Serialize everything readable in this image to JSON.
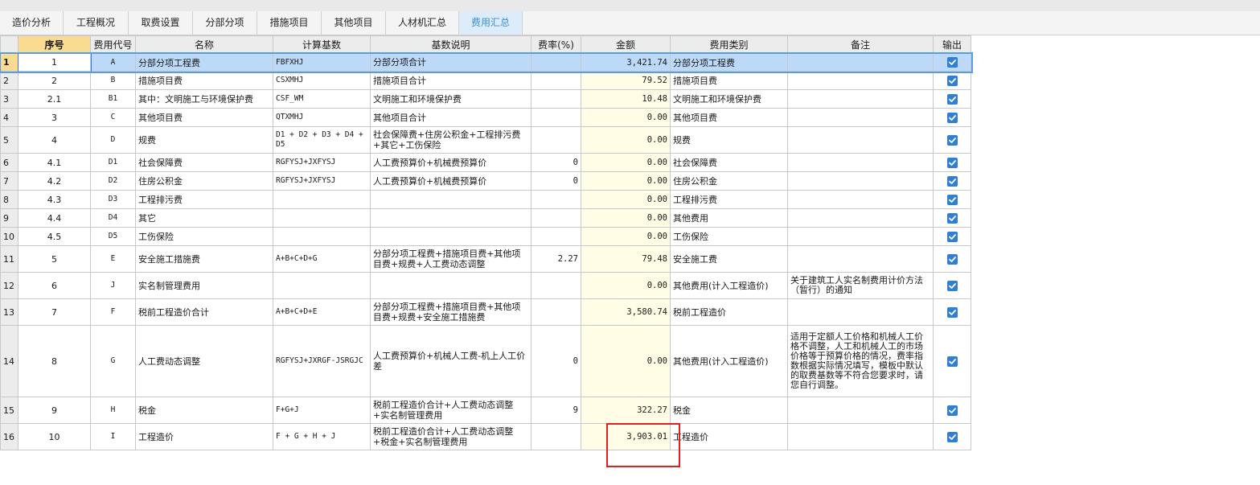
{
  "tabs": [
    {
      "label": "造价分析"
    },
    {
      "label": "工程概况"
    },
    {
      "label": "取费设置"
    },
    {
      "label": "分部分项"
    },
    {
      "label": "措施项目"
    },
    {
      "label": "其他项目"
    },
    {
      "label": "人材机汇总"
    },
    {
      "label": "费用汇总"
    }
  ],
  "table": {
    "headers": [
      "序号",
      "费用代号",
      "名称",
      "计算基数",
      "基数说明",
      "费率(%)",
      "金额",
      "费用类别",
      "备注",
      "输出"
    ],
    "rows": [
      {
        "rn": "1",
        "seq": "1",
        "code": "A",
        "name": "分部分项工程费",
        "base": "FBFXHJ",
        "desc": "分部分项合计",
        "rate": "",
        "amount": "3,421.74",
        "category": "分部分项工程费",
        "note": "",
        "output": true
      },
      {
        "rn": "2",
        "seq": "2",
        "code": "B",
        "name": "措施项目费",
        "base": "CSXMHJ",
        "desc": "措施项目合计",
        "rate": "",
        "amount": "79.52",
        "category": "措施项目费",
        "note": "",
        "output": true
      },
      {
        "rn": "3",
        "seq": "2.1",
        "code": "B1",
        "name": "其中：文明施工与环境保护费",
        "base": "CSF_WM",
        "desc": "文明施工和环境保护费",
        "rate": "",
        "amount": "10.48",
        "category": "文明施工和环境保护费",
        "note": "",
        "output": true
      },
      {
        "rn": "4",
        "seq": "3",
        "code": "C",
        "name": "其他项目费",
        "base": "QTXMHJ",
        "desc": "其他项目合计",
        "rate": "",
        "amount": "0.00",
        "category": "其他项目费",
        "note": "",
        "output": true
      },
      {
        "rn": "5",
        "seq": "4",
        "code": "D",
        "name": "规费",
        "base": "D1 + D2 + D3 + D4 + D5",
        "desc": "社会保障费+住房公积金+工程排污费+其它+工伤保险",
        "rate": "",
        "amount": "0.00",
        "category": "规费",
        "note": "",
        "output": true
      },
      {
        "rn": "6",
        "seq": "4.1",
        "code": "D1",
        "name": "社会保障费",
        "base": "RGFYSJ+JXFYSJ",
        "desc": "人工费预算价+机械费预算价",
        "rate": "0",
        "amount": "0.00",
        "category": "社会保障费",
        "note": "",
        "output": true
      },
      {
        "rn": "7",
        "seq": "4.2",
        "code": "D2",
        "name": "住房公积金",
        "base": "RGFYSJ+JXFYSJ",
        "desc": "人工费预算价+机械费预算价",
        "rate": "0",
        "amount": "0.00",
        "category": "住房公积金",
        "note": "",
        "output": true
      },
      {
        "rn": "8",
        "seq": "4.3",
        "code": "D3",
        "name": "工程排污费",
        "base": "",
        "desc": "",
        "rate": "",
        "amount": "0.00",
        "category": "工程排污费",
        "note": "",
        "output": true
      },
      {
        "rn": "9",
        "seq": "4.4",
        "code": "D4",
        "name": "其它",
        "base": "",
        "desc": "",
        "rate": "",
        "amount": "0.00",
        "category": "其他费用",
        "note": "",
        "output": true
      },
      {
        "rn": "10",
        "seq": "4.5",
        "code": "D5",
        "name": "工伤保险",
        "base": "",
        "desc": "",
        "rate": "",
        "amount": "0.00",
        "category": "工伤保险",
        "note": "",
        "output": true
      },
      {
        "rn": "11",
        "seq": "5",
        "code": "E",
        "name": "安全施工措施费",
        "base": "A+B+C+D+G",
        "desc": "分部分项工程费+措施项目费+其他项目费+规费+人工费动态调整",
        "rate": "2.27",
        "amount": "79.48",
        "category": "安全施工费",
        "note": "",
        "output": true
      },
      {
        "rn": "12",
        "seq": "6",
        "code": "J",
        "name": "实名制管理费用",
        "base": "",
        "desc": "",
        "rate": "",
        "amount": "0.00",
        "category": "其他费用(计入工程造价)",
        "note": "关于建筑工人实名制费用计价方法（暂行）的通知",
        "output": true
      },
      {
        "rn": "13",
        "seq": "7",
        "code": "F",
        "name": "税前工程造价合计",
        "base": "A+B+C+D+E",
        "desc": "分部分项工程费+措施项目费+其他项目费+规费+安全施工措施费",
        "rate": "",
        "amount": "3,580.74",
        "category": "税前工程造价",
        "note": "",
        "output": true
      },
      {
        "rn": "14",
        "seq": "8",
        "code": "G",
        "name": "人工费动态调整",
        "base": "RGFYSJ+JXRGF-JSRGJC",
        "desc": "人工费预算价+机械人工费-机上人工价差",
        "rate": "0",
        "amount": "0.00",
        "category": "其他费用(计入工程造价)",
        "note": "适用于定额人工价格和机械人工价格不调整，人工和机械人工的市场价格等于预算价格的情况，费率指数根据实际情况填写，模板中默认的取费基数等不符合您要求时，请您自行调整。",
        "output": true
      },
      {
        "rn": "15",
        "seq": "9",
        "code": "H",
        "name": "税金",
        "base": "F+G+J",
        "desc": "税前工程造价合计+人工费动态调整+实名制管理费用",
        "rate": "9",
        "amount": "322.27",
        "category": "税金",
        "note": "",
        "output": true
      },
      {
        "rn": "16",
        "seq": "10",
        "code": "I",
        "name": "工程造价",
        "base": "F + G + H + J",
        "desc": "税前工程造价合计+人工费动态调整+税金+实名制管理费用",
        "rate": "",
        "amount": "3,903.01",
        "category": "工程造价",
        "note": "",
        "output": true
      }
    ]
  },
  "colors": {
    "active_tab": "#3b8fd8",
    "selection": "#bcd9f7",
    "highlight_header": "#f9dc92",
    "amount_bg": "#fffde6",
    "checkbox": "#2f7fd6",
    "annotation": "#e02020"
  }
}
